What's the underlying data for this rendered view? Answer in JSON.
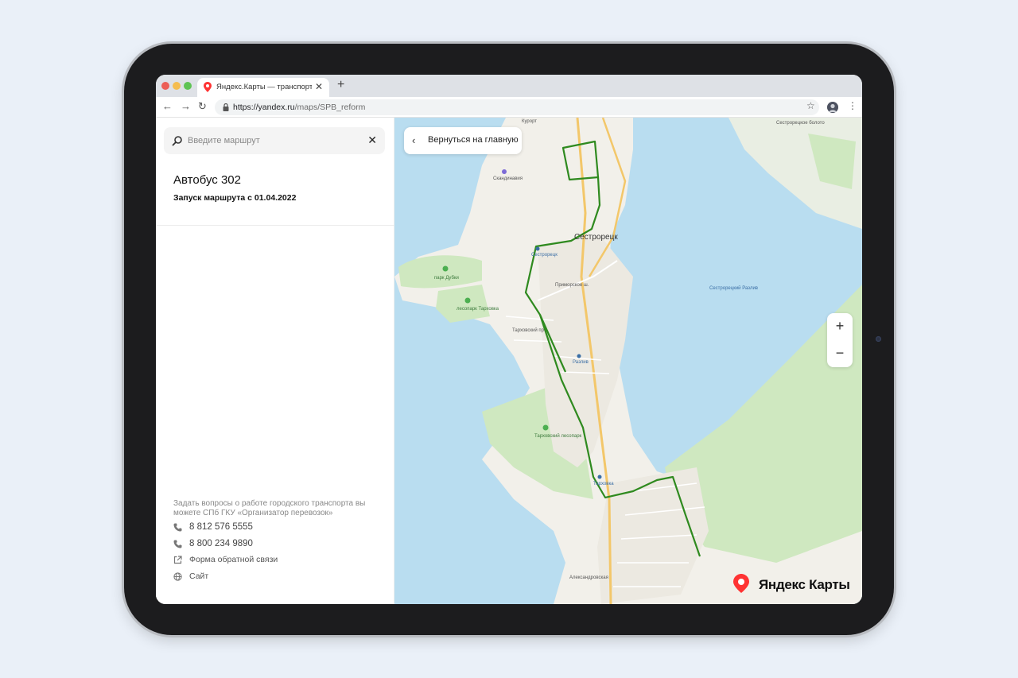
{
  "browser": {
    "tab_title": "Яндекс.Карты — транспорт, на",
    "tab_close": "✕",
    "new_tab": "+",
    "url_host": "https://yandex.ru",
    "url_path": "/maps/SPB_reform",
    "nav": {
      "back": "←",
      "forward": "→",
      "reload": "↻"
    },
    "star": "☆",
    "menu": "⋮"
  },
  "sidebar": {
    "search_placeholder": "Введите маршрут",
    "search_clear": "✕",
    "route_title": "Автобус 302",
    "route_subtitle": "Запуск маршрута с 01.04.2022",
    "info_text": "Задать вопросы о работе городского транспорта вы можете СПб ГКУ «Организатор перевозок»",
    "contacts": [
      {
        "icon": "phone-icon",
        "text": "8 812 576 5555"
      },
      {
        "icon": "phone-icon",
        "text": "8 800 234 9890"
      },
      {
        "icon": "external-link-icon",
        "text": "Форма обратной связи"
      },
      {
        "icon": "globe-icon",
        "text": "Сайт"
      }
    ]
  },
  "map": {
    "back_button": "Вернуться на главную",
    "back_icon": "‹",
    "zoom_in": "+",
    "zoom_out": "−",
    "logo_text": "Яндекс Карты",
    "labels": {
      "sestroretsk": "Сестрорецк",
      "sestroretsk_station": "Сестрорецк",
      "razliv_station": "Разлив",
      "tarhovka_station": "Тарховка",
      "sestroretsky_razliv": "Сестрорецкий Разлив",
      "park_dubki": "парк Дубки",
      "lesopark_tarhovka": "лесопарк Тарховка",
      "tarhovsky_lesopark": "Тарховский лесопарк",
      "kurort": "Курорт",
      "skandinavia": "Скандинавия",
      "sestroretskoe_bolota": "Сестрорецкое болото",
      "primorskoe_sh": "Приморское ш.",
      "aleksandrovskaya": "Александровская",
      "tarkhovsky_pr": "Тарховский пр."
    },
    "colors": {
      "water": "#b9ddf0",
      "land": "#f2f0ea",
      "forest": "#cfe8c0",
      "route": "#2f8a1f"
    }
  }
}
